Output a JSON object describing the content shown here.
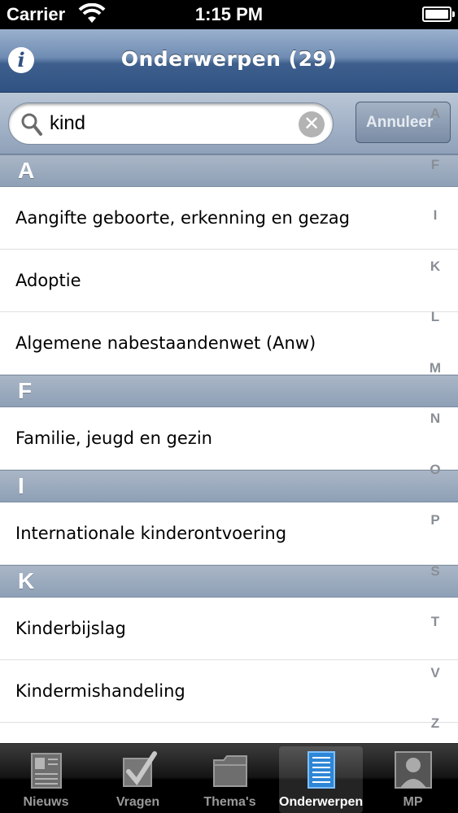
{
  "status": {
    "carrier": "Carrier",
    "time": "1:15 PM"
  },
  "nav": {
    "title": "Onderwerpen (29)",
    "info_icon": "info-icon"
  },
  "search": {
    "value": "kind",
    "cancel_label": "Annuleer"
  },
  "sections": [
    {
      "letter": "A",
      "items": [
        "Aangifte geboorte, erkenning en gezag",
        "Adoptie",
        "Algemene nabestaandenwet (Anw)"
      ]
    },
    {
      "letter": "F",
      "items": [
        "Familie, jeugd en gezin"
      ]
    },
    {
      "letter": "I",
      "items": [
        "Internationale kinderontvoering"
      ]
    },
    {
      "letter": "K",
      "items": [
        "Kinderbijslag",
        "Kindermishandeling"
      ]
    }
  ],
  "index": [
    "A",
    "F",
    "I",
    "K",
    "L",
    "M",
    "N",
    "O",
    "P",
    "S",
    "T",
    "V",
    "Z"
  ],
  "tabs": [
    {
      "label": "Nieuws",
      "icon": "newspaper-icon"
    },
    {
      "label": "Vragen",
      "icon": "checkbox-icon"
    },
    {
      "label": "Thema's",
      "icon": "folder-icon"
    },
    {
      "label": "Onderwerpen",
      "icon": "list-icon",
      "active": true
    },
    {
      "label": "MP",
      "icon": "person-icon"
    }
  ],
  "colors": {
    "nav_blue": "#2f5283",
    "section_gray": "#9aa9bd",
    "index_gray": "#8a8f96"
  }
}
